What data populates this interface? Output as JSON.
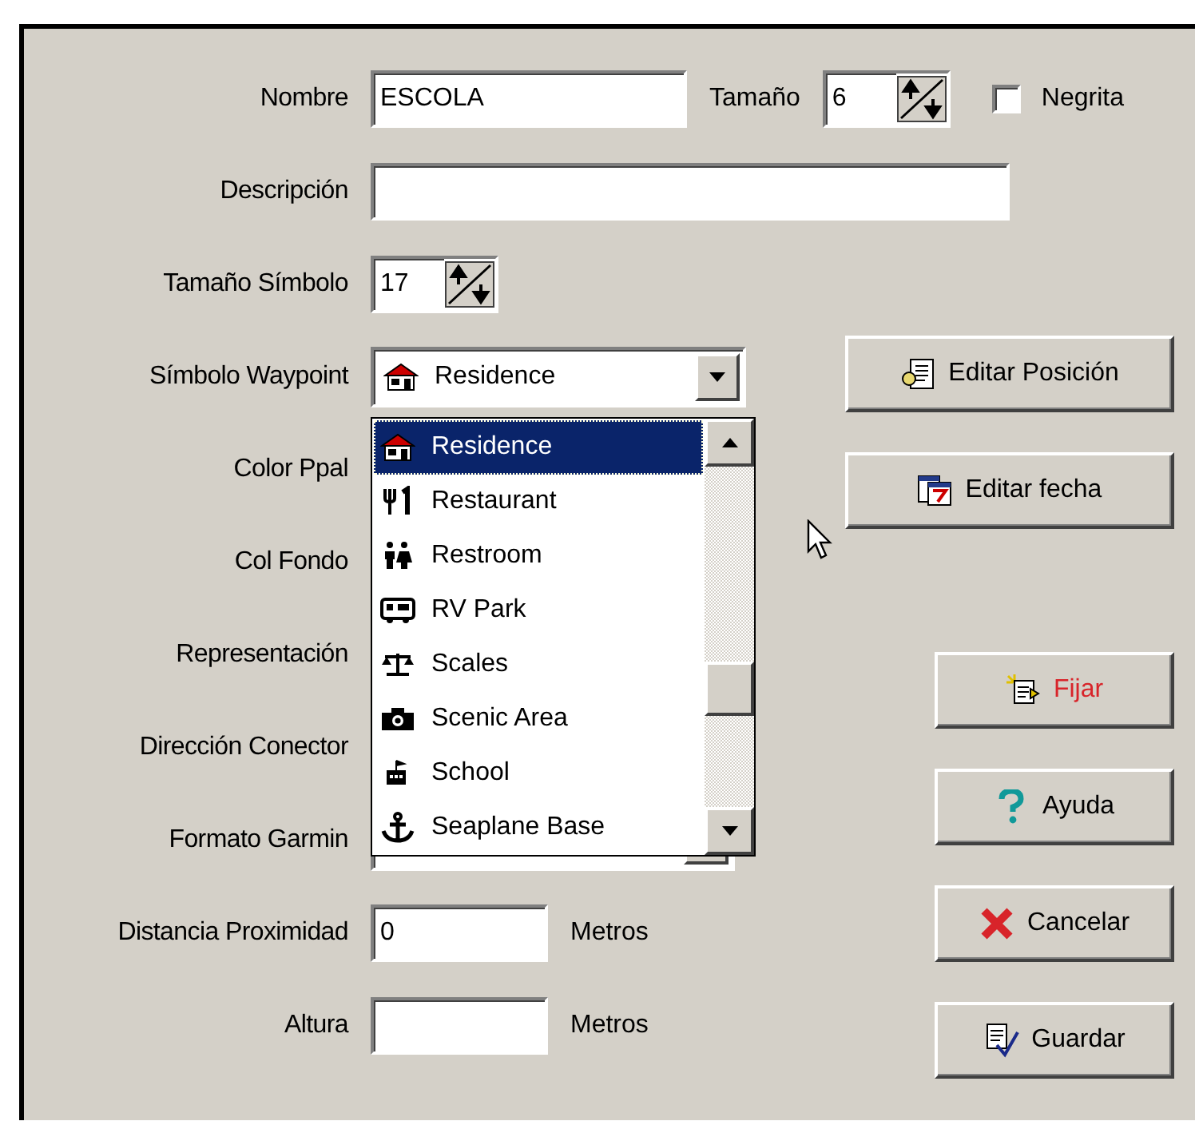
{
  "rows": [
    {
      "kind": "name",
      "label": "Nombre",
      "value": "ESCOLA",
      "size_label": "Tamaño",
      "size_value": "6",
      "bold_label": "Negrita",
      "bold_checked": false
    },
    {
      "kind": "text",
      "label": "Descripción"
    },
    {
      "kind": "spinner",
      "label": "Tamaño Símbolo",
      "value": "17"
    },
    {
      "kind": "combo",
      "label": "Símbolo Waypoint",
      "value": "Residence",
      "expanded": true,
      "options": [
        {
          "label": "Residence",
          "selected": true
        },
        {
          "label": "Restaurant",
          "selected": false
        },
        {
          "label": "Restroom",
          "selected": false
        },
        {
          "label": "RV Park",
          "selected": false
        },
        {
          "label": "Scales",
          "selected": false
        },
        {
          "label": "Scenic Area",
          "selected": false
        },
        {
          "label": "School",
          "selected": false
        },
        {
          "label": "Seaplane Base",
          "selected": false
        }
      ]
    },
    {
      "kind": "covered",
      "label": "Color Ppal"
    },
    {
      "kind": "covered",
      "label": "Col Fondo"
    },
    {
      "kind": "covered",
      "label": "Representación"
    },
    {
      "kind": "covered",
      "label": "Dirección Conector"
    },
    {
      "kind": "covered_combo",
      "label": "Formato Garmin"
    },
    {
      "kind": "unit",
      "label": "Distancia Proximidad",
      "value": "0",
      "unit": "Metros"
    },
    {
      "kind": "unit",
      "label": "Altura",
      "unit": "Metros"
    }
  ],
  "buttons": [
    {
      "label": "Editar Posición",
      "color": "#000000"
    },
    {
      "label": "Editar fecha",
      "color": "#000000"
    },
    {
      "label": "Fijar",
      "color": "#d8242a"
    },
    {
      "label": "Ayuda",
      "color": "#000000"
    },
    {
      "label": "Cancelar",
      "color": "#000000"
    },
    {
      "label": "Guardar",
      "color": "#000000"
    }
  ]
}
